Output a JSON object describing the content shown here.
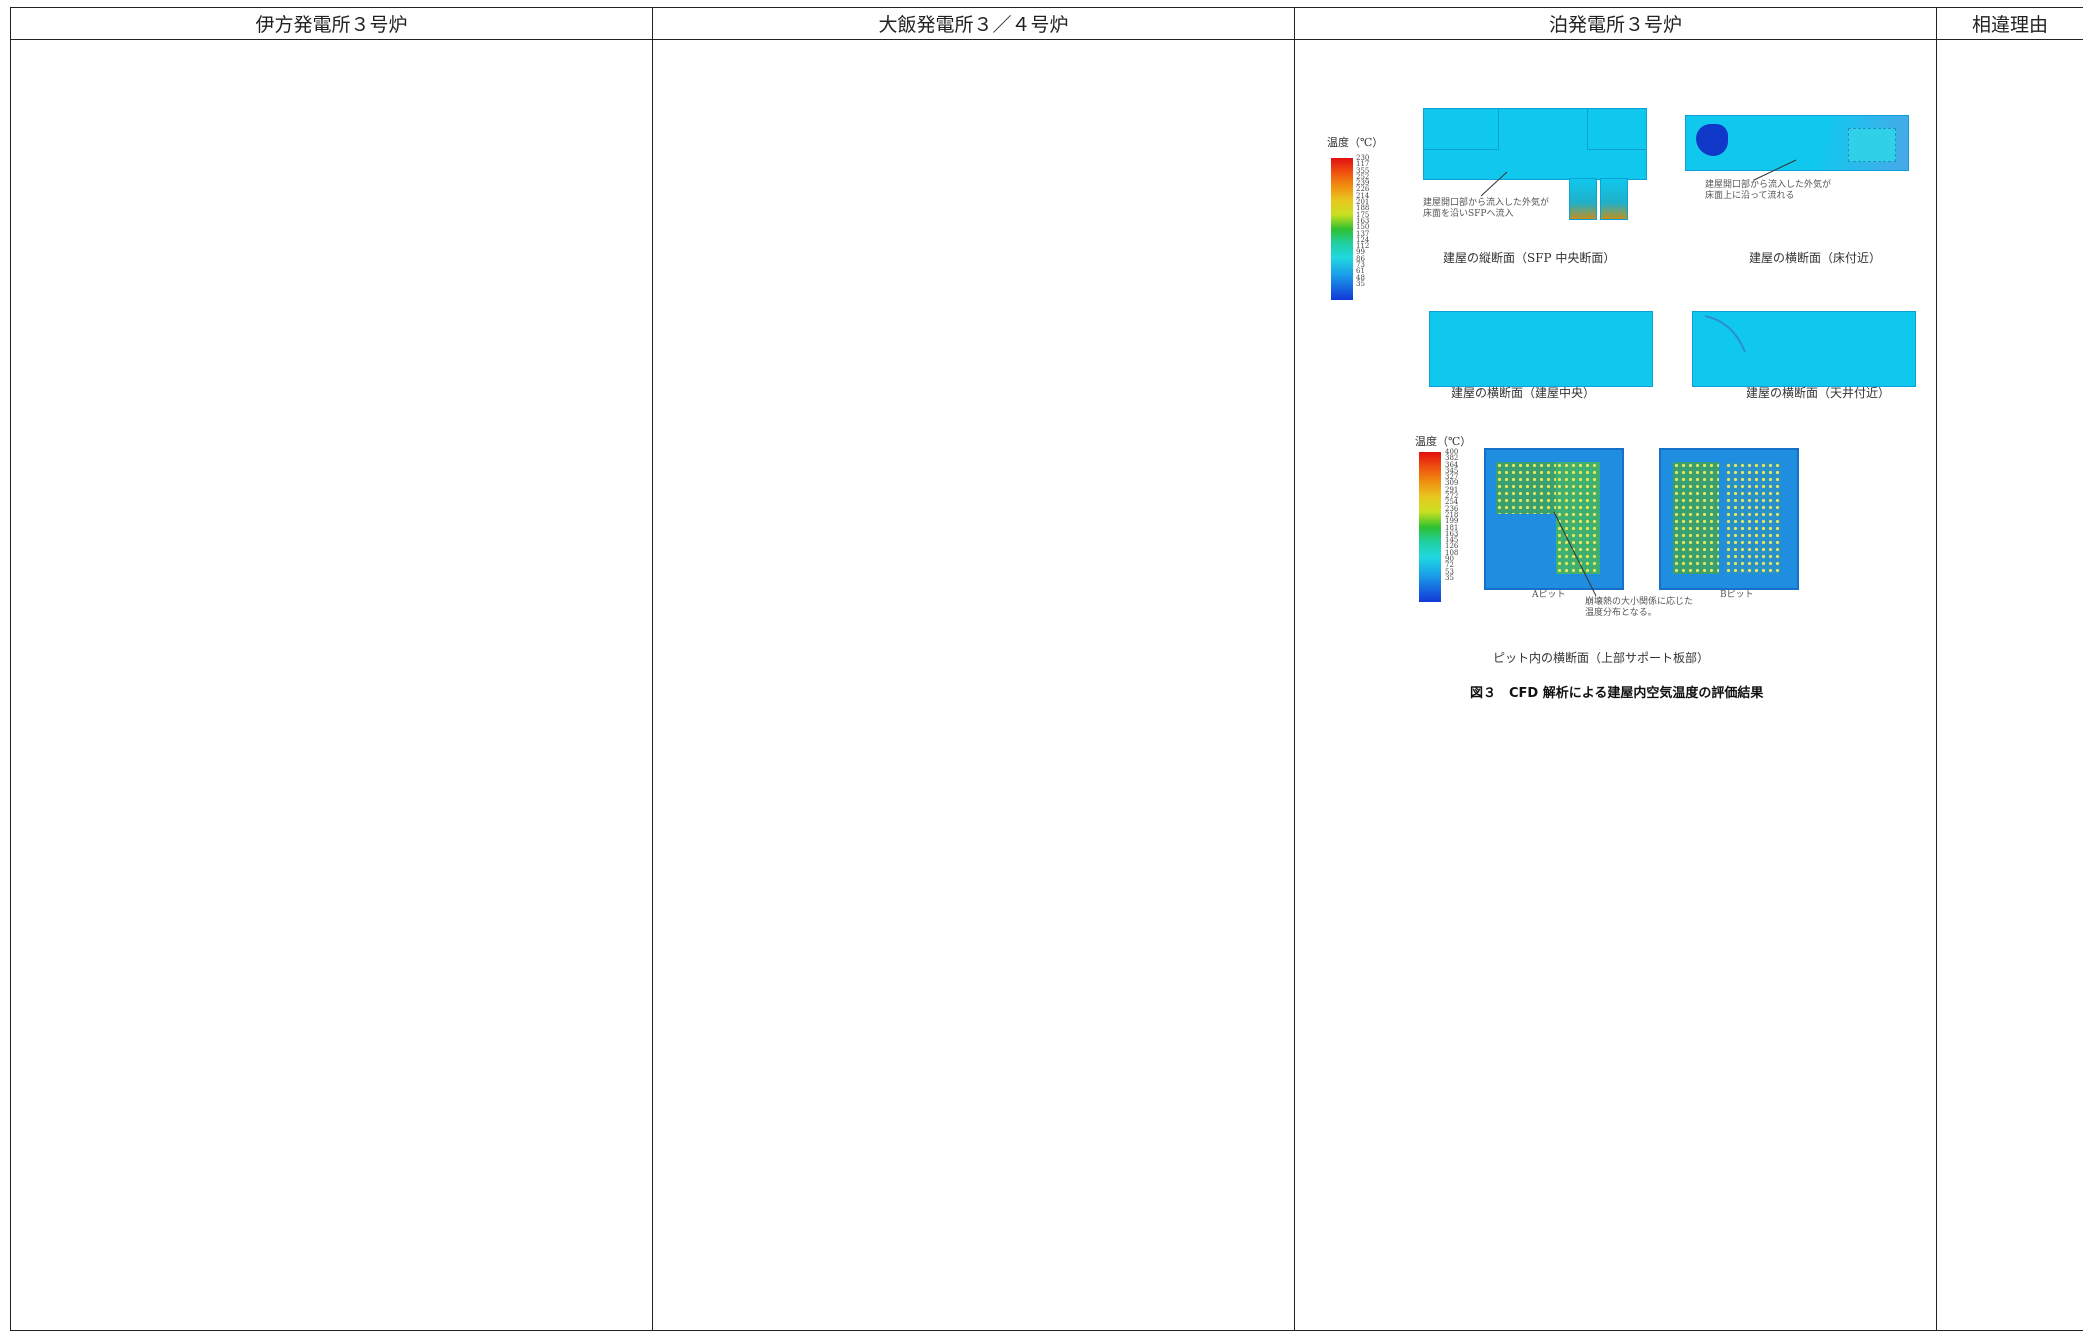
{
  "header": {
    "col1": "伊方発電所３号炉",
    "col2": "大飯発電所３／４号炉",
    "col3": "泊発電所３号炉",
    "col4": "相違理由"
  },
  "figure": {
    "legend1": {
      "title": "温度（℃）",
      "ticks": [
        "230",
        "117",
        "355",
        "252",
        "239",
        "226",
        "214",
        "201",
        "188",
        "175",
        "163",
        "150",
        "137",
        "124",
        "112",
        "99",
        "86",
        "73",
        "61",
        "48",
        "35"
      ]
    },
    "panels": {
      "top_left_note": "建屋開口部から流入した外気が\n床面を沿いSFPへ流入",
      "top_right_note": "建屋開口部から流入した外気が\n床面上に沿って流れる",
      "label_vertical": "建屋の縦断面（SFP 中央断面）",
      "label_horizontal_floor": "建屋の横断面（床付近）",
      "label_horizontal_center": "建屋の横断面（建屋中央）",
      "label_horizontal_ceiling": "建屋の横断面（天井付近）"
    },
    "legend2": {
      "title": "温度（℃）",
      "ticks": [
        "400",
        "382",
        "364",
        "345",
        "327",
        "309",
        "291",
        "272",
        "254",
        "236",
        "218",
        "199",
        "181",
        "163",
        "145",
        "126",
        "108",
        "90",
        "72",
        "53",
        "35"
      ]
    },
    "pits": {
      "pit_a": "Aピット",
      "pit_b": "Bピット",
      "note": "崩壊熱の大小関係に応じた\n温度分布となる。",
      "label": "ピット内の横断面（上部サポート板部）"
    },
    "caption": "図３　CFD 解析による建屋内空気温度の評価結果"
  }
}
